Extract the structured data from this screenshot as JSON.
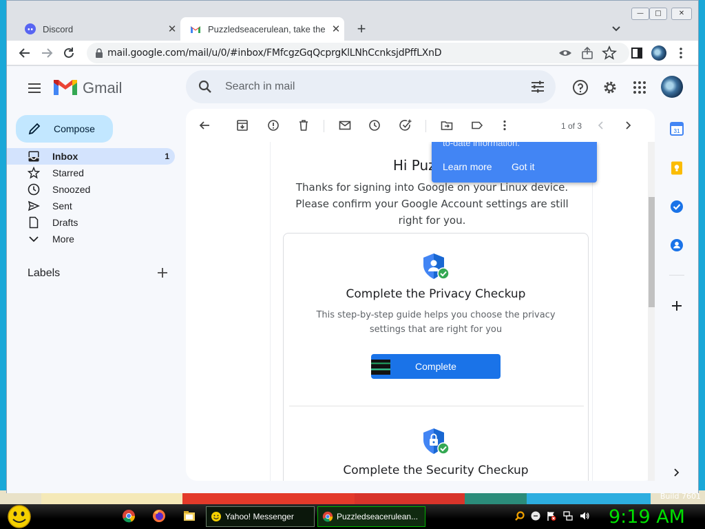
{
  "browser": {
    "tabs": [
      {
        "title": "Discord",
        "active": false
      },
      {
        "title": "Puzzledseacerulean, take the ne",
        "active": true
      }
    ],
    "new_tab_symbol": "+",
    "url": "mail.google.com/mail/u/0/#inbox/FMfcgzGqQcprgKlLNhCcnksjdPffLXnD"
  },
  "gmail": {
    "app_name": "Gmail",
    "search_placeholder": "Search in mail",
    "compose_label": "Compose",
    "nav": [
      {
        "label": "Inbox",
        "count": "1",
        "icon": "inbox-icon",
        "active": true
      },
      {
        "label": "Starred",
        "count": "",
        "icon": "star-icon"
      },
      {
        "label": "Snoozed",
        "count": "",
        "icon": "clock-icon"
      },
      {
        "label": "Sent",
        "count": "",
        "icon": "send-icon"
      },
      {
        "label": "Drafts",
        "count": "",
        "icon": "draft-icon"
      },
      {
        "label": "More",
        "count": "",
        "icon": "chevron-down-icon"
      }
    ],
    "labels_title": "Labels",
    "pager": "1 of 3",
    "message": {
      "greeting": "Hi Puzzleds",
      "intro": "Thanks for signing into Google on your Linux device. Please confirm your Google Account settings are still right for you.",
      "checkups": [
        {
          "title": "Complete the Privacy Checkup",
          "description": "This step-by-step guide helps you choose the privacy settings that are right for you",
          "button": "Complete"
        },
        {
          "title": "Complete the Security Checkup"
        }
      ]
    },
    "popup": {
      "text_partial": "to-date information.",
      "learn_more": "Learn more",
      "got_it": "Got it"
    }
  },
  "taskbar": {
    "windows": [
      {
        "label": "Yahoo! Messenger",
        "active": false
      },
      {
        "label": "Puzzledseacerulean...",
        "active": true
      }
    ],
    "clock": "9:19 AM"
  },
  "desktop": {
    "build_text": "Build 7601"
  },
  "colors": {
    "accent": "#1a73e8",
    "compose_bg": "#c2e7ff",
    "active_nav": "#d3e3fd",
    "popup_bg": "#4285f4",
    "clock": "#00e000"
  }
}
